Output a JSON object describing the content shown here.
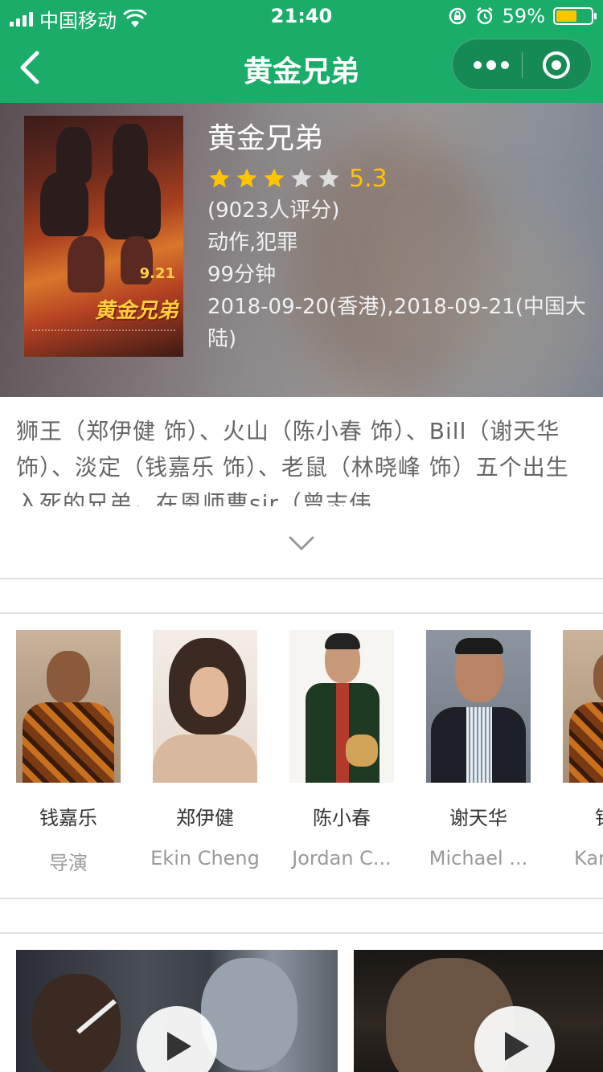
{
  "status_bar": {
    "carrier": "中国移动",
    "time": "21:40",
    "battery_percent": "59%",
    "battery_level": 0.59,
    "icons": [
      "signal-icon",
      "wifi-icon",
      "rotation-lock-icon",
      "alarm-icon",
      "battery-icon"
    ]
  },
  "nav": {
    "title": "黄金兄弟",
    "back_icon": "chevron-left-icon",
    "more_icon": "more-dots-icon",
    "close_icon": "target-close-icon",
    "bar_color": "#1aad6a"
  },
  "movie": {
    "title": "黄金兄弟",
    "rating_stars": 3,
    "rating_stars_max": 5,
    "rating": "5.3",
    "rating_count": "(9023人评分)",
    "genres": "动作,犯罪",
    "duration": "99分钟",
    "release": "2018-09-20(香港),2018-09-21(中国大陆)",
    "poster": {
      "date": "9.21",
      "logo": "黄金兄弟"
    }
  },
  "synopsis": "狮王（郑伊健 饰）、火山（陈小春 饰）、Bill（谢天华 饰）、淡定（钱嘉乐 饰）、老鼠（林晓峰 饰）五个出生入死的兄弟，在恩师曹sir（曾志伟",
  "cast": [
    {
      "name": "钱嘉乐",
      "role": "导演"
    },
    {
      "name": "郑伊健",
      "role": "Ekin Cheng"
    },
    {
      "name": "陈小春",
      "role": "Jordan C..."
    },
    {
      "name": "谢天华",
      "role": "Michael ..."
    },
    {
      "name": "钱",
      "role": "Kar"
    }
  ],
  "colors": {
    "accent": "#1aad6a",
    "star_on": "#ffc300",
    "star_off": "#dddddd"
  }
}
